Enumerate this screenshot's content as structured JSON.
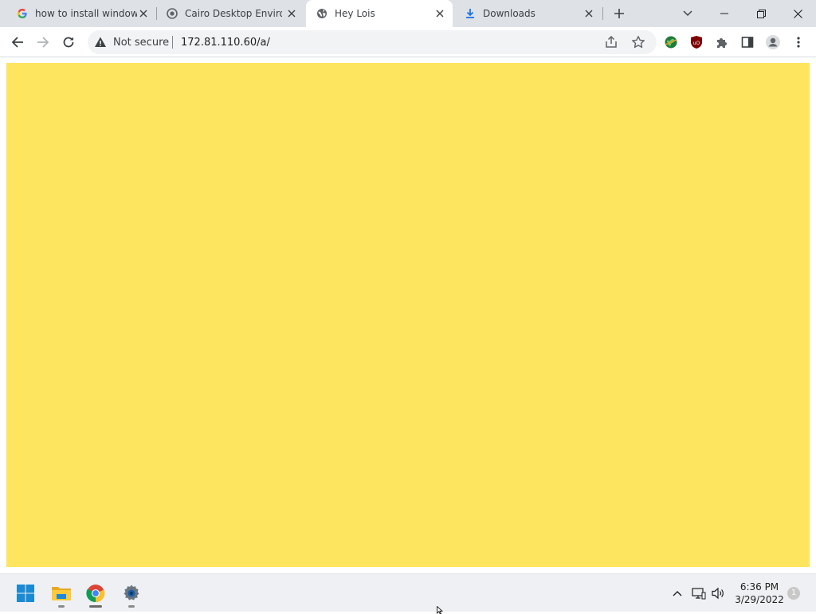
{
  "tabs": [
    {
      "title": "how to install windows",
      "icon": "google-g-icon",
      "active": false
    },
    {
      "title": "Cairo Desktop Environ",
      "icon": "cairo-icon",
      "active": false
    },
    {
      "title": "Hey Lois",
      "icon": "globe-icon",
      "active": true
    },
    {
      "title": "Downloads",
      "icon": "download-icon",
      "active": false
    }
  ],
  "omnibox": {
    "security_label": "Not secure",
    "url": "172.81.110.60/a/"
  },
  "page": {
    "background_color": "#fee55f"
  },
  "taskbar": {
    "time": "6:36 PM",
    "date": "3/29/2022",
    "notification_count": "1"
  },
  "colors": {
    "tabstrip": "#dee1e6",
    "taskbar": "#eef0f3",
    "page_yellow": "#fee55f"
  }
}
